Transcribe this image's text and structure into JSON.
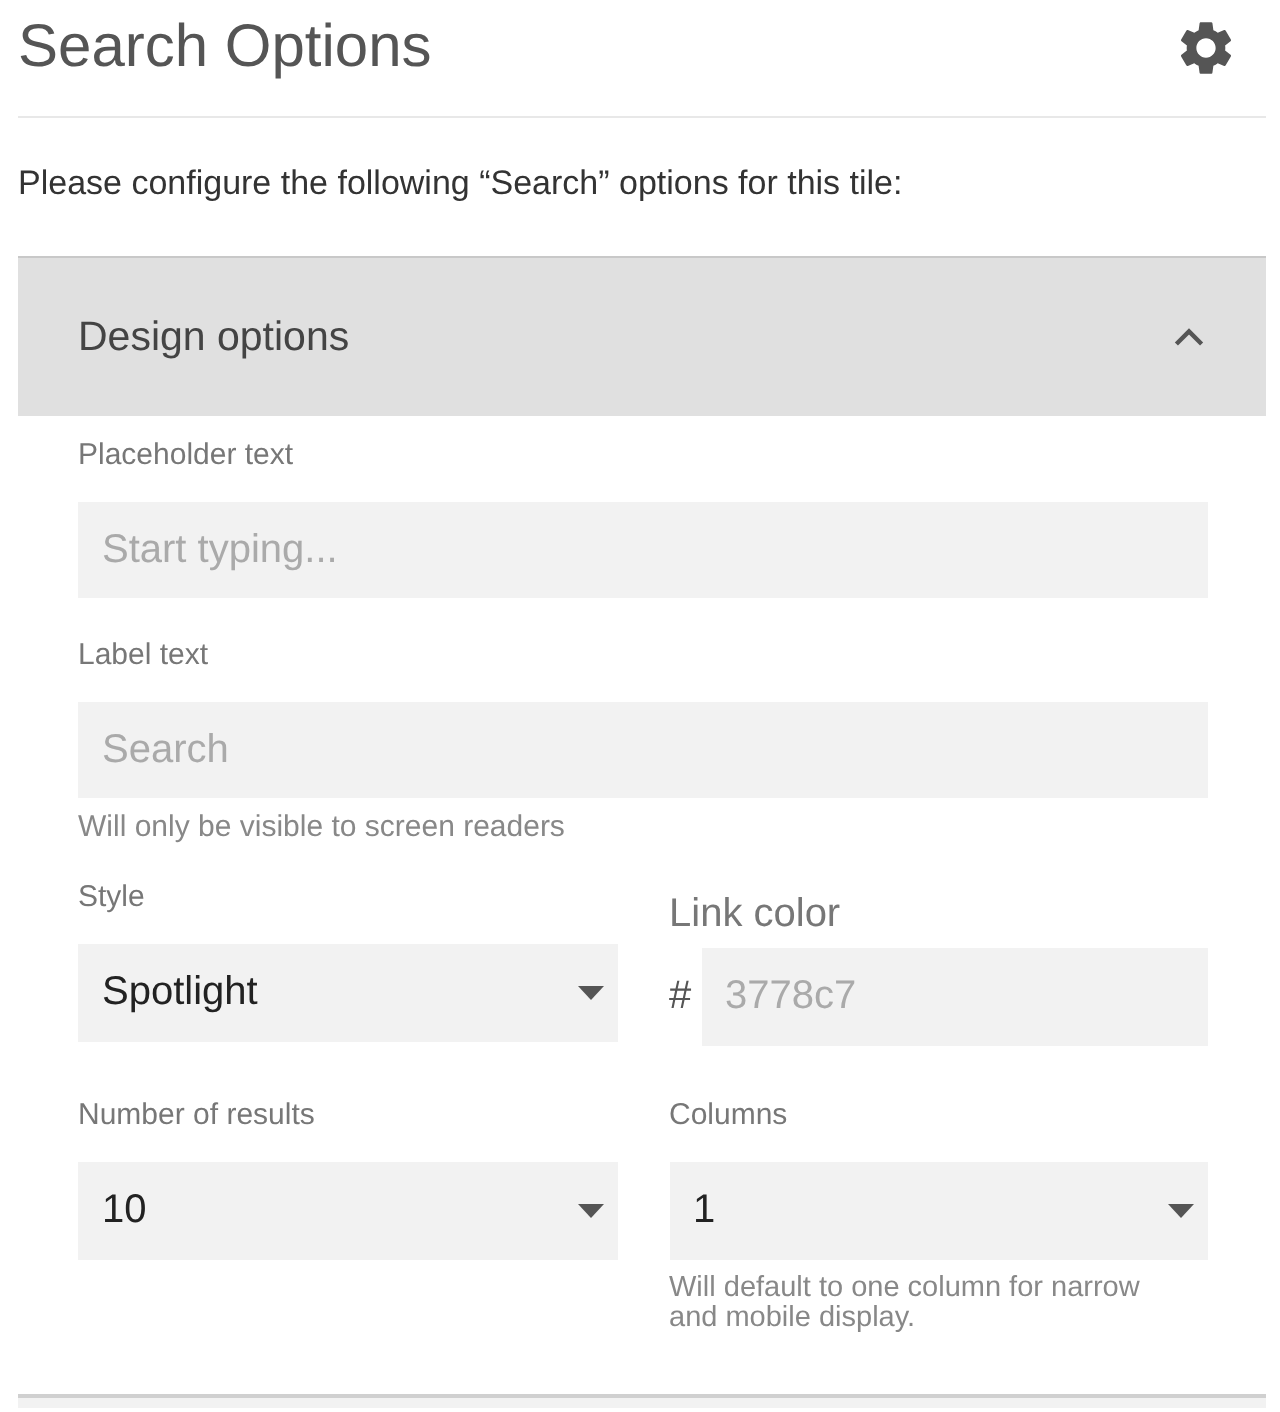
{
  "header": {
    "title": "Search Options"
  },
  "intro": "Please configure the following “Search” options for this tile:",
  "panel": {
    "title": "Design options",
    "expanded": true,
    "fields": [
      {
        "kind": "text",
        "label": "Placeholder text",
        "placeholder": "Start typing..."
      },
      {
        "kind": "text",
        "label": "Label text",
        "placeholder": "Search",
        "hint": "Will only be visible to screen readers"
      }
    ],
    "grid": [
      {
        "kind": "select",
        "label": "Style",
        "value": "Spotlight"
      },
      {
        "kind": "color",
        "label": "Link color",
        "prefix": "#",
        "placeholder": "3778c7"
      },
      {
        "kind": "select",
        "label": "Number of results",
        "value": "10"
      },
      {
        "kind": "select",
        "label": "Columns",
        "value": "1",
        "hint": "Will default to one column for narrow and mobile display."
      }
    ]
  }
}
